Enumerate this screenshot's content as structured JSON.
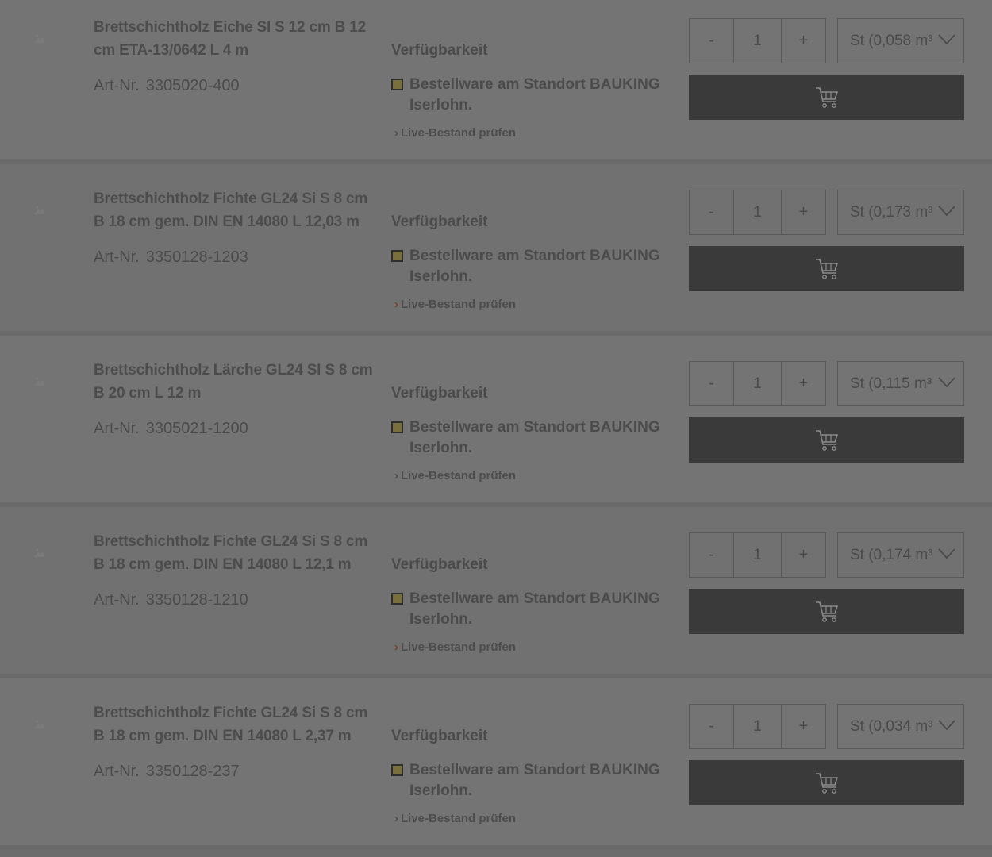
{
  "labels": {
    "art_nr": "Art-Nr.",
    "availability": "Verfügbarkeit",
    "live_stock": "Live-Bestand prüfen",
    "minus": "-",
    "plus": "+"
  },
  "colors": {
    "overlay_bg": "#6c6c6c",
    "cart_button": "#3a3a3a",
    "status_dot": "#77703a",
    "live_arrow_red": "#7a3b3b"
  },
  "icons": {
    "thumbnail": "image-placeholder-icon",
    "cart": "cart-icon",
    "dropdown": "chevron-down-icon"
  },
  "products": [
    {
      "title": "Brettschichtholz Eiche SI S 12 cm B 12 cm ETA-13/0642 L 4 m",
      "art_nr": "3305020-400",
      "status": "Bestellware am Standort BAUKING Iserlohn.",
      "quantity": "1",
      "unit": "St (0,058 m³",
      "live_arrow_red": false
    },
    {
      "title": "Brettschichtholz Fichte GL24 Si S 8 cm B 18 cm gem. DIN EN 14080 L 12,03 m",
      "art_nr": "3350128-1203",
      "status": "Bestellware am Standort BAUKING Iserlohn.",
      "quantity": "1",
      "unit": "St (0,173 m³",
      "live_arrow_red": true
    },
    {
      "title": "Brettschichtholz Lärche GL24 SI S 8 cm B 20 cm L 12 m",
      "art_nr": "3305021-1200",
      "status": "Bestellware am Standort BAUKING Iserlohn.",
      "quantity": "1",
      "unit": "St (0,115 m³",
      "live_arrow_red": false
    },
    {
      "title": "Brettschichtholz Fichte GL24 Si S 8 cm B 18 cm gem. DIN EN 14080 L 12,1 m",
      "art_nr": "3350128-1210",
      "status": "Bestellware am Standort BAUKING Iserlohn.",
      "quantity": "1",
      "unit": "St (0,174 m³",
      "live_arrow_red": true
    },
    {
      "title": "Brettschichtholz Fichte GL24 Si S 8 cm B 18 cm gem. DIN EN 14080 L 2,37 m",
      "art_nr": "3350128-237",
      "status": "Bestellware am Standort BAUKING Iserlohn.",
      "quantity": "1",
      "unit": "St (0,034 m³",
      "live_arrow_red": false
    }
  ]
}
